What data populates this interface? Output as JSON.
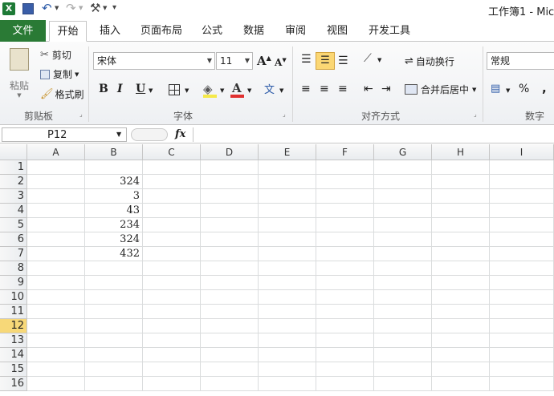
{
  "title": "工作簿1 - Mic",
  "tabs": {
    "file": "文件",
    "home": "开始",
    "insert": "插入",
    "page_layout": "页面布局",
    "formulas": "公式",
    "data": "数据",
    "review": "审阅",
    "view": "视图",
    "developer": "开发工具"
  },
  "clipboard": {
    "paste": "粘贴",
    "cut": "剪切",
    "copy": "复制",
    "format_painter": "格式刷",
    "label": "剪贴板"
  },
  "font": {
    "name": "宋体",
    "size": "11",
    "bold": "B",
    "italic": "I",
    "underline": "U",
    "label": "字体",
    "font_color": "#e03030",
    "fill_color": "#f5e94a"
  },
  "alignment": {
    "wrap": "自动换行",
    "merge": "合并后居中",
    "label": "对齐方式"
  },
  "number": {
    "format": "常规",
    "label": "数字",
    "percent": "%"
  },
  "formula_bar": {
    "name_box": "P12",
    "fx": "fx",
    "value": ""
  },
  "sheet": {
    "columns": [
      "A",
      "B",
      "C",
      "D",
      "E",
      "F",
      "G",
      "H",
      "I"
    ],
    "rows": [
      "1",
      "2",
      "3",
      "4",
      "5",
      "6",
      "7",
      "8",
      "9",
      "10",
      "11",
      "12",
      "13",
      "14",
      "15",
      "16"
    ],
    "active_row": "12",
    "column_b_values": [
      "",
      "324",
      "3",
      "43",
      "234",
      "324",
      "432",
      "",
      "",
      "",
      "",
      "",
      "",
      "",
      "",
      ""
    ]
  },
  "colors": {
    "file_tab": "#2a7a35",
    "active_header": "#f7d878"
  }
}
